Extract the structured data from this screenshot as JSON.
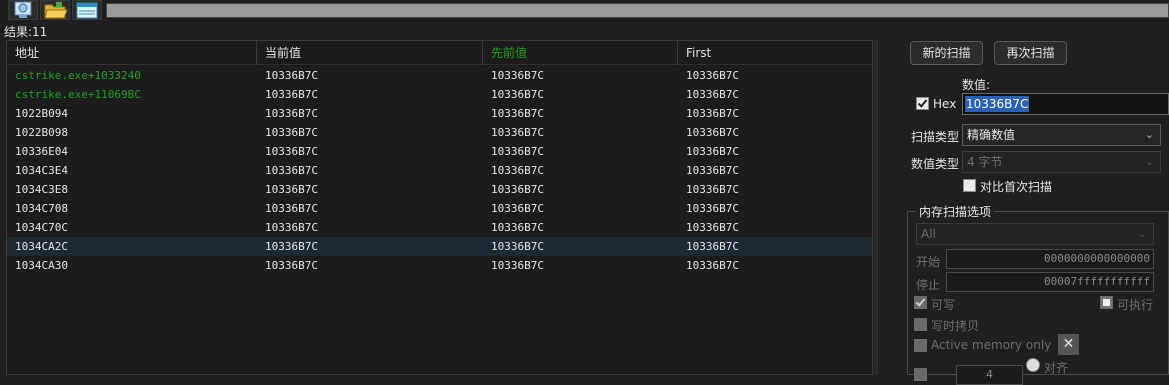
{
  "toolbar": {
    "buttons": [
      {
        "name": "process-list-icon"
      },
      {
        "name": "open-folder-icon"
      },
      {
        "name": "save-table-icon"
      }
    ]
  },
  "results": {
    "label": "结果:11"
  },
  "table": {
    "columns": [
      {
        "label": "地址"
      },
      {
        "label": "当前值"
      },
      {
        "label": "先前值"
      },
      {
        "label": "First"
      }
    ],
    "rows": [
      {
        "address": "cstrike.exe+1033240",
        "current": "10336B7C",
        "previous": "10336B7C",
        "first": "10336B7C",
        "static": true
      },
      {
        "address": "cstrike.exe+11069BC",
        "current": "10336B7C",
        "previous": "10336B7C",
        "first": "10336B7C",
        "static": true
      },
      {
        "address": "1022B094",
        "current": "10336B7C",
        "previous": "10336B7C",
        "first": "10336B7C"
      },
      {
        "address": "1022B098",
        "current": "10336B7C",
        "previous": "10336B7C",
        "first": "10336B7C"
      },
      {
        "address": "10336E04",
        "current": "10336B7C",
        "previous": "10336B7C",
        "first": "10336B7C"
      },
      {
        "address": "1034C3E4",
        "current": "10336B7C",
        "previous": "10336B7C",
        "first": "10336B7C"
      },
      {
        "address": "1034C3E8",
        "current": "10336B7C",
        "previous": "10336B7C",
        "first": "10336B7C"
      },
      {
        "address": "1034C708",
        "current": "10336B7C",
        "previous": "10336B7C",
        "first": "10336B7C"
      },
      {
        "address": "1034C70C",
        "current": "10336B7C",
        "previous": "10336B7C",
        "first": "10336B7C"
      },
      {
        "address": "1034CA2C",
        "current": "10336B7C",
        "previous": "10336B7C",
        "first": "10336B7C",
        "selected": true
      },
      {
        "address": "1034CA30",
        "current": "10336B7C",
        "previous": "10336B7C",
        "first": "10336B7C"
      }
    ]
  },
  "scan": {
    "new_scan": "新的扫描",
    "next_scan": "再次扫描",
    "value_label": "数值:",
    "hex_label": "Hex",
    "hex_checked": true,
    "value": "10336B7C",
    "scan_type_label": "扫描类型",
    "scan_type": "精确数值",
    "value_type_label": "数值类型",
    "value_type": "4 字节",
    "compare_first": "对比首次扫描"
  },
  "memory": {
    "title": "内存扫描选项",
    "region": "All",
    "start_label": "开始",
    "start": "0000000000000000",
    "stop_label": "停止",
    "stop": "00007fffffffffff",
    "writable": "可写",
    "executable": "可执行",
    "copy_on_write": "写时拷贝",
    "active_only": "Active memory only",
    "align": "对齐",
    "fast_scan_value": "4"
  },
  "colors": {
    "accent_green": "#1fa31f",
    "selection": "#2a62b8"
  }
}
